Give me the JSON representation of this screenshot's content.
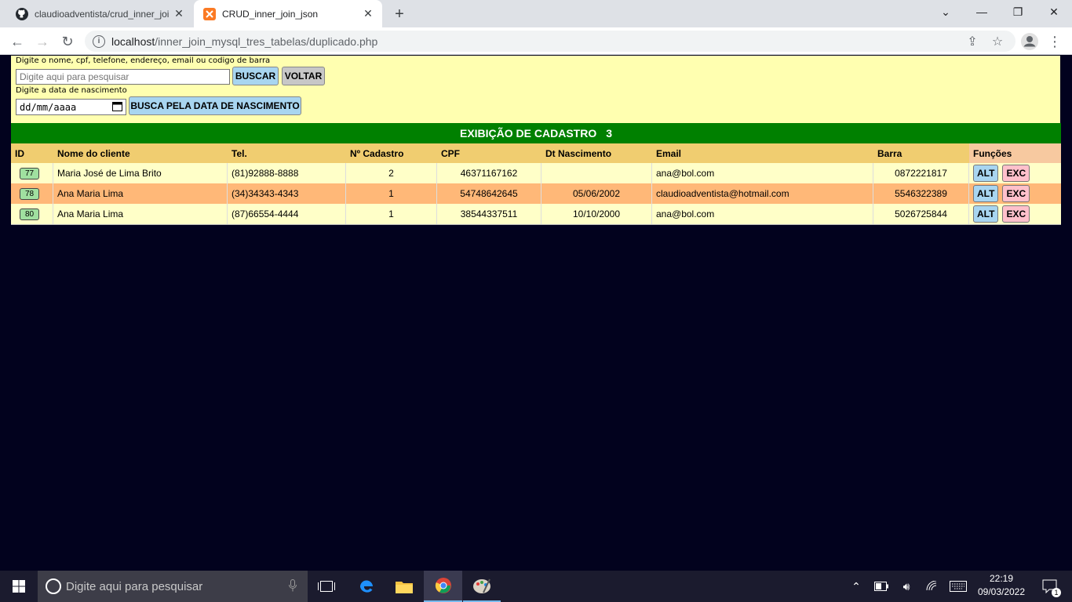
{
  "browser": {
    "tabs": [
      {
        "title": "claudioadventista/crud_inner_joi",
        "icon": "github-icon"
      },
      {
        "title": "CRUD_inner_join_json",
        "icon": "xampp-icon"
      }
    ],
    "url_host": "localhost",
    "url_path": "/inner_join_mysql_tres_tabelas/duplicado.php"
  },
  "search": {
    "label1": "Digite o nome, cpf, telefone, endereço, email ou codigo de barra",
    "placeholder": "Digite aqui para pesquisar",
    "buscar_label": "BUSCAR",
    "voltar_label": "VOLTAR",
    "label2": "Digite a data de nascimento",
    "date_placeholder": "dd/mm/aaaa",
    "date_button_label": "BUSCA PELA  DATA DE  NASCIMENTO"
  },
  "table": {
    "title": "EXIBIÇÃO DE CADASTRO",
    "count": "3",
    "headers": {
      "id": "ID",
      "nome": "Nome do cliente",
      "tel": "Tel.",
      "cadastro": "Nº Cadastro",
      "cpf": "CPF",
      "nasc": "Dt Nascimento",
      "email": "Email",
      "barra": "Barra",
      "funcoes": "Funções"
    },
    "rows": [
      {
        "id": "77",
        "nome": "Maria José de Lima Brito",
        "tel": "(81)92888-8888",
        "cadastro": "2",
        "cpf": "46371167162",
        "nasc": "",
        "email": "ana@bol.com",
        "barra": "0872221817",
        "alt": "ALT",
        "exc": "EXC"
      },
      {
        "id": "78",
        "nome": "Ana Maria Lima",
        "tel": "(34)34343-4343",
        "cadastro": "1",
        "cpf": "54748642645",
        "nasc": "05/06/2002",
        "email": "claudioadventista@hotmail.com",
        "barra": "5546322389",
        "alt": "ALT",
        "exc": "EXC"
      },
      {
        "id": "80",
        "nome": "Ana Maria Lima",
        "tel": "(87)66554-4444",
        "cadastro": "1",
        "cpf": "38544337511",
        "nasc": "10/10/2000",
        "email": "ana@bol.com",
        "barra": "5026725844",
        "alt": "ALT",
        "exc": "EXC"
      }
    ]
  },
  "taskbar": {
    "search_placeholder": "Digite aqui para pesquisar",
    "time": "22:19",
    "date": "09/03/2022",
    "notifications": "1"
  }
}
